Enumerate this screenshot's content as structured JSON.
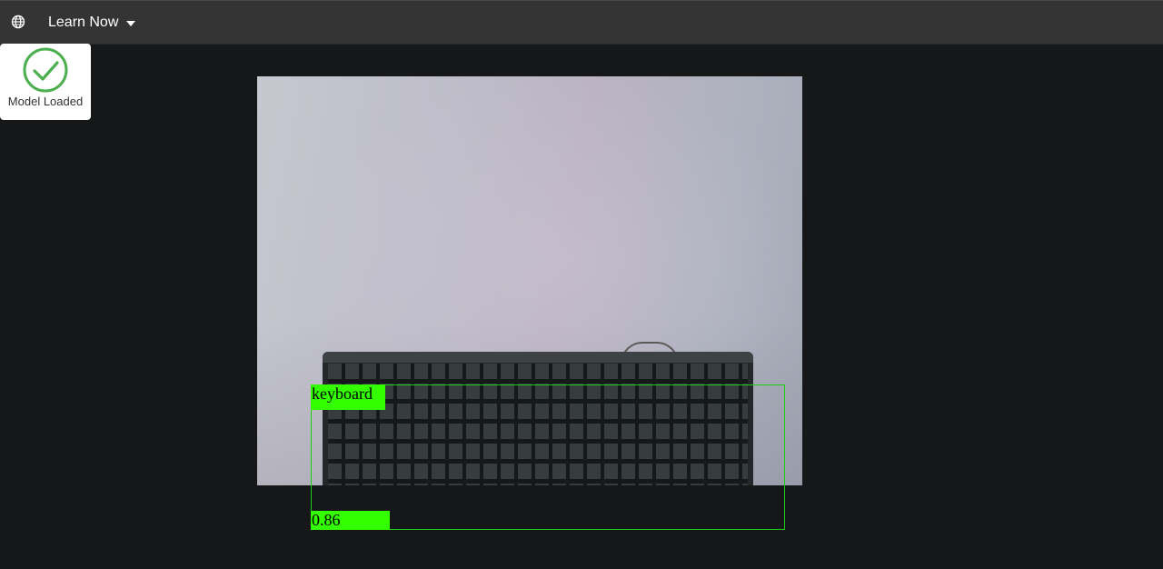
{
  "navbar": {
    "menu_label": "Learn Now",
    "globe_icon": "globe-icon",
    "caret_icon": "caret-down-icon"
  },
  "status": {
    "text": "Model Loaded",
    "icon": "check-circle-icon",
    "color": "#4caf50"
  },
  "detection": {
    "label": "keyboard",
    "score": "0.86",
    "box_color": "#1fcc14",
    "tag_color": "#33ff00"
  }
}
